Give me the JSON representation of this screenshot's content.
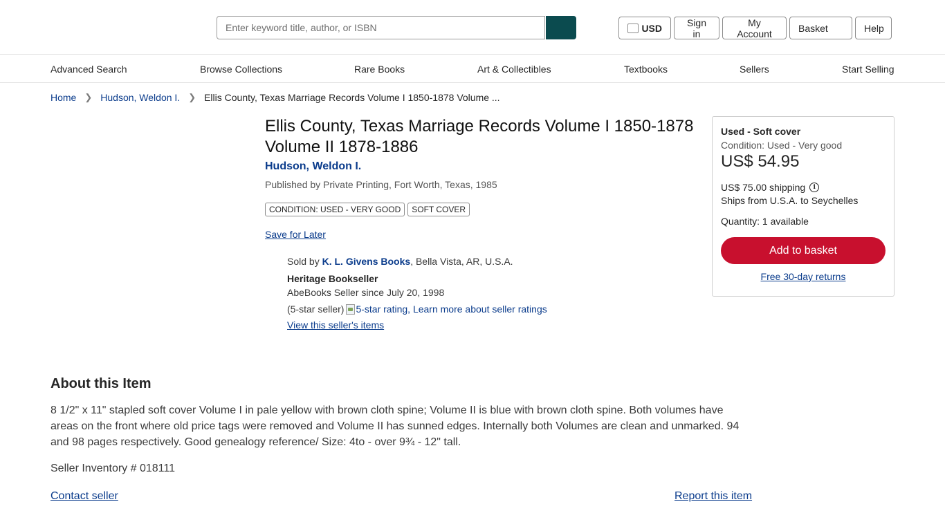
{
  "header": {
    "search_placeholder": "Enter keyword title, author, or ISBN",
    "currency": "USD",
    "sign_in": "Sign in",
    "my_account": "My Account",
    "basket": "Basket",
    "help": "Help",
    "accent_color": "#0b4b4f"
  },
  "nav": {
    "items": [
      "Advanced Search",
      "Browse Collections",
      "Rare Books",
      "Art & Collectibles",
      "Textbooks",
      "Sellers",
      "Start Selling"
    ]
  },
  "breadcrumb": {
    "home": "Home",
    "author": "Hudson, Weldon I.",
    "current": "Ellis County, Texas Marriage Records Volume I 1850-1878 Volume ..."
  },
  "product": {
    "title": "Ellis County, Texas Marriage Records Volume I 1850-1878 Volume II 1878-1886",
    "author": "Hudson, Weldon I.",
    "publisher": "Published by Private Printing, Fort Worth, Texas, 1985",
    "badges": [
      "CONDITION: USED - VERY GOOD",
      "SOFT COVER"
    ],
    "save_for_later": "Save for Later"
  },
  "seller": {
    "sold_by": "Sold by",
    "name": "K. L. Givens Books",
    "location": ", Bella Vista, AR, U.S.A.",
    "badge": "Heritage Bookseller",
    "since": "AbeBooks Seller since July 20, 1998",
    "rating_text": "(5-star seller)",
    "rating_alt": "5-star rating,",
    "learn_more": "Learn more about seller ratings",
    "view_items": "View this seller's items"
  },
  "buybox": {
    "binding": "Used - Soft cover",
    "condition": "Condition: Used - Very good",
    "price": "US$ 54.95",
    "shipping": "US$ 75.00 shipping",
    "ships_from": "Ships from U.S.A. to Seychelles",
    "quantity": "Quantity: 1 available",
    "add_to_basket": "Add to basket",
    "returns": "Free 30-day returns",
    "button_color": "#c8102e"
  },
  "about": {
    "heading": "About this Item",
    "description": "8 1/2\" x 11\" stapled soft cover Volume I in pale yellow with brown cloth spine; Volume II is blue with brown cloth spine. Both volumes have areas on the front where old price tags were removed and Volume II has sunned edges. Internally both Volumes are clean and unmarked. 94 and 98 pages respectively. Good genealogy reference/ Size: 4to - over 9¾ - 12\" tall.",
    "inventory": "Seller Inventory # 018111",
    "contact": "Contact seller",
    "report": "Report this item"
  }
}
